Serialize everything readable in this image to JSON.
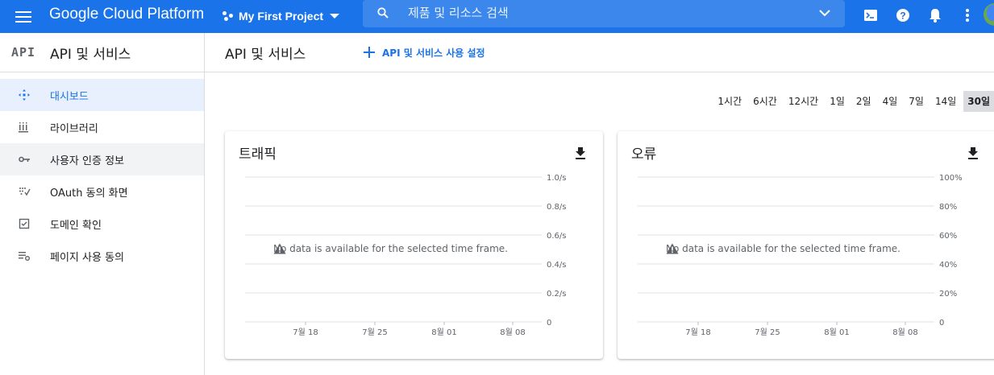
{
  "topbar": {
    "brand": "Google Cloud Platform",
    "project": "My First Project",
    "search_placeholder": "제품 및 리소스 검색",
    "icons": [
      "menu-icon",
      "project-dots-icon",
      "search-icon",
      "chevron-down-icon",
      "cloud-shell-icon",
      "help-icon",
      "notifications-icon",
      "more-vert-icon",
      "avatar"
    ]
  },
  "sidebar": {
    "logo": "API",
    "title": "API 및 서비스",
    "items": [
      {
        "label": "대시보드",
        "icon": "dashboard-icon",
        "active": true
      },
      {
        "label": "라이브러리",
        "icon": "library-icon"
      },
      {
        "label": "사용자 인증 정보",
        "icon": "key-icon"
      },
      {
        "label": "OAuth 동의 화면",
        "icon": "oauth-icon"
      },
      {
        "label": "도메인 확인",
        "icon": "checkbox-icon"
      },
      {
        "label": "페이지 사용 동의",
        "icon": "settings-list-icon"
      }
    ]
  },
  "main": {
    "title": "API 및 서비스",
    "enable_button": "API 및 서비스 사용 설정",
    "ranges": [
      "1시간",
      "6시간",
      "12시간",
      "1일",
      "2일",
      "4일",
      "7일",
      "14일",
      "30일"
    ],
    "selected_range": "30일"
  },
  "cards": [
    {
      "title": "트래픽",
      "message": "No data is available for the selected time frame.",
      "download_icon": "download-icon",
      "warning_icon": "warning-icon"
    },
    {
      "title": "오류",
      "message": "No data is available for the selected time frame.",
      "download_icon": "download-icon",
      "warning_icon": "warning-icon"
    }
  ],
  "chart_data": [
    {
      "type": "line",
      "title": "트래픽",
      "x_ticks": [
        "7월 18",
        "7월 25",
        "8월 01",
        "8월 08"
      ],
      "y_ticks": [
        "1.0/s",
        "0.8/s",
        "0.6/s",
        "0.4/s",
        "0.2/s",
        "0"
      ],
      "ylim": [
        0,
        1.0
      ],
      "series": [],
      "grid": true
    },
    {
      "type": "line",
      "title": "오류",
      "x_ticks": [
        "7월 18",
        "7월 25",
        "8월 01",
        "8월 08"
      ],
      "y_ticks": [
        "100%",
        "80%",
        "60%",
        "40%",
        "20%",
        "0"
      ],
      "ylim": [
        0,
        100
      ],
      "series": [],
      "grid": true
    }
  ],
  "colors": {
    "primary": "#1a73e8",
    "active_bg": "#e8f0fe",
    "border": "#dadce0"
  }
}
